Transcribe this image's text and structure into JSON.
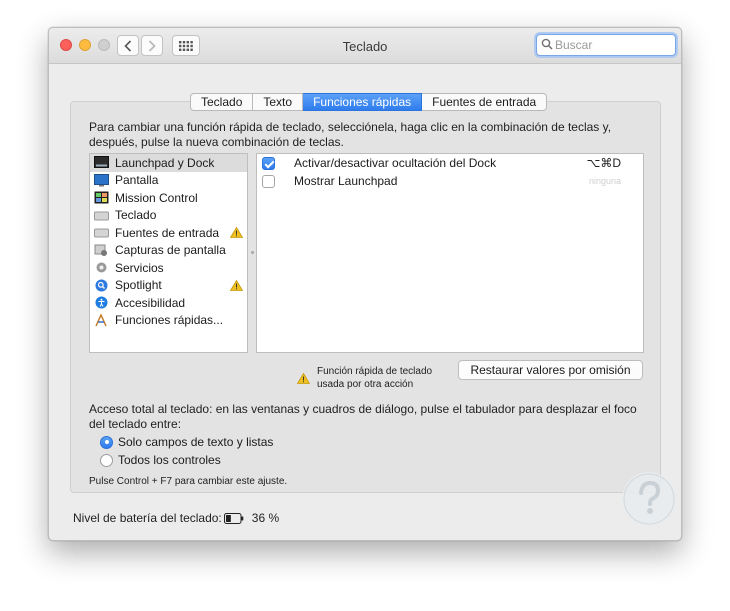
{
  "window": {
    "title": "Teclado"
  },
  "search": {
    "placeholder": "Buscar",
    "value": ""
  },
  "tabs": [
    {
      "label": "Teclado",
      "active": false
    },
    {
      "label": "Texto",
      "active": false
    },
    {
      "label": "Funciones rápidas",
      "active": true
    },
    {
      "label": "Fuentes de entrada",
      "active": false
    }
  ],
  "instructions": "Para cambiar una función rápida de teclado, selecciónela, haga clic en la combinación de teclas y, después, pulse la nueva combinación de teclas.",
  "categories": [
    {
      "label": "Launchpad y Dock",
      "icon": "launchpad-dock-icon",
      "selected": true,
      "warning": false
    },
    {
      "label": "Pantalla",
      "icon": "display-icon",
      "selected": false,
      "warning": false
    },
    {
      "label": "Mission Control",
      "icon": "mission-control-icon",
      "selected": false,
      "warning": false
    },
    {
      "label": "Teclado",
      "icon": "keyboard-icon",
      "selected": false,
      "warning": false
    },
    {
      "label": "Fuentes de entrada",
      "icon": "input-sources-icon",
      "selected": false,
      "warning": true
    },
    {
      "label": "Capturas de pantalla",
      "icon": "screenshot-icon",
      "selected": false,
      "warning": false
    },
    {
      "label": "Servicios",
      "icon": "services-gear-icon",
      "selected": false,
      "warning": false
    },
    {
      "label": "Spotlight",
      "icon": "spotlight-icon",
      "selected": false,
      "warning": true
    },
    {
      "label": "Accesibilidad",
      "icon": "accessibility-icon",
      "selected": false,
      "warning": false
    },
    {
      "label": "Funciones rápidas...",
      "icon": "app-shortcuts-icon",
      "selected": false,
      "warning": false
    }
  ],
  "shortcuts": [
    {
      "label": "Activar/desactivar ocultación del Dock",
      "checked": true,
      "key": "⌥⌘D",
      "dim": false
    },
    {
      "label": "Mostrar Launchpad",
      "checked": false,
      "key": "ninguna",
      "dim": true
    }
  ],
  "warning_legend": {
    "line1": "Función rápida de teclado",
    "line2": "usada por otra acción"
  },
  "restore_button": "Restaurar valores por omisión",
  "full_access": {
    "text": "Acceso total al teclado: en las ventanas y cuadros de diálogo, pulse el tabulador para desplazar el foco del teclado entre:",
    "options": [
      {
        "label": "Solo campos de texto y listas",
        "selected": true
      },
      {
        "label": "Todos los controles",
        "selected": false
      }
    ],
    "hint": "Pulse Control + F7 para cambiar este ajuste."
  },
  "battery": {
    "label": "Nivel de batería del teclado:",
    "level_percent": 36,
    "value": "36 %"
  },
  "colors": {
    "accent": "#2f7ded",
    "window_bg": "#ececec",
    "warning": "#f0c020"
  }
}
